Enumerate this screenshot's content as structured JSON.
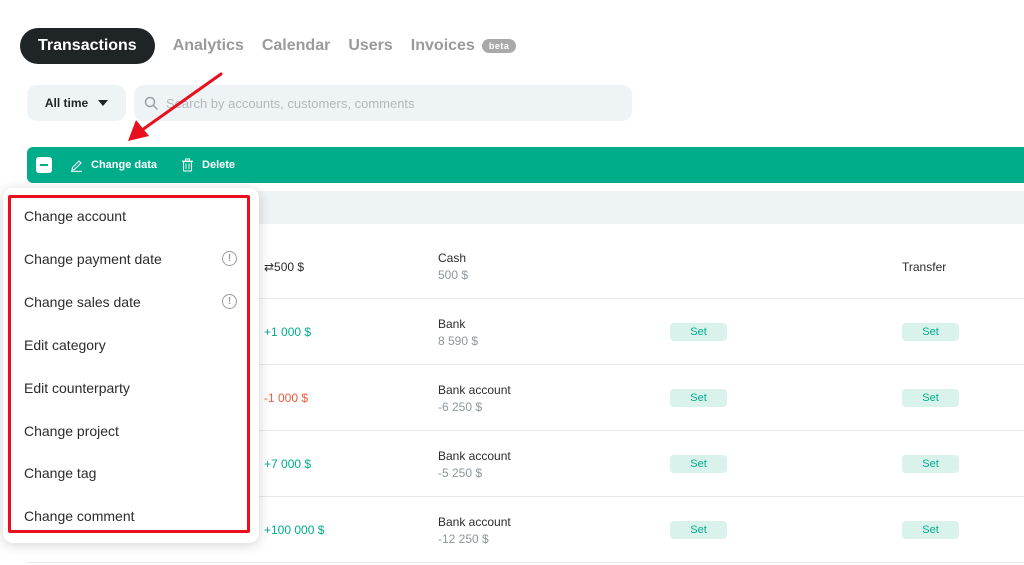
{
  "tabs": [
    {
      "label": "Transactions",
      "active": true
    },
    {
      "label": "Analytics"
    },
    {
      "label": "Calendar"
    },
    {
      "label": "Users"
    },
    {
      "label": "Invoices",
      "badge": "beta"
    }
  ],
  "filters": {
    "period": "All time",
    "search_placeholder": "Search by accounts, customers, comments"
  },
  "actionbar": {
    "change_data": "Change data",
    "delete": "Delete"
  },
  "rows": [
    {
      "amount": "⇄500  $",
      "account": "Cash",
      "balance": "500  $",
      "type": "Transfer"
    },
    {
      "amount": "+1 000  $",
      "account": "Bank",
      "balance": "8 590  $",
      "set1": "Set",
      "set2": "Set"
    },
    {
      "amount": "-1 000  $",
      "account": "Bank account",
      "balance": "-6 250  $",
      "set1": "Set",
      "set2": "Set"
    },
    {
      "amount": "+7 000  $",
      "account": "Bank account",
      "balance": "-5 250  $",
      "set1": "Set",
      "set2": "Set"
    },
    {
      "amount": "+100 000  $",
      "account": "Bank account",
      "balance": "-12 250  $",
      "set1": "Set",
      "set2": "Set"
    }
  ],
  "menu": {
    "items": [
      "Change account",
      "Change payment date",
      "Change sales date",
      "Edit category",
      "Edit counterparty",
      "Change project",
      "Change tag",
      "Change comment"
    ],
    "info_glyph": "!"
  },
  "colors": {
    "accent": "#00ad8b",
    "negative": "#f05a3a",
    "highlight": "#e8101e"
  }
}
